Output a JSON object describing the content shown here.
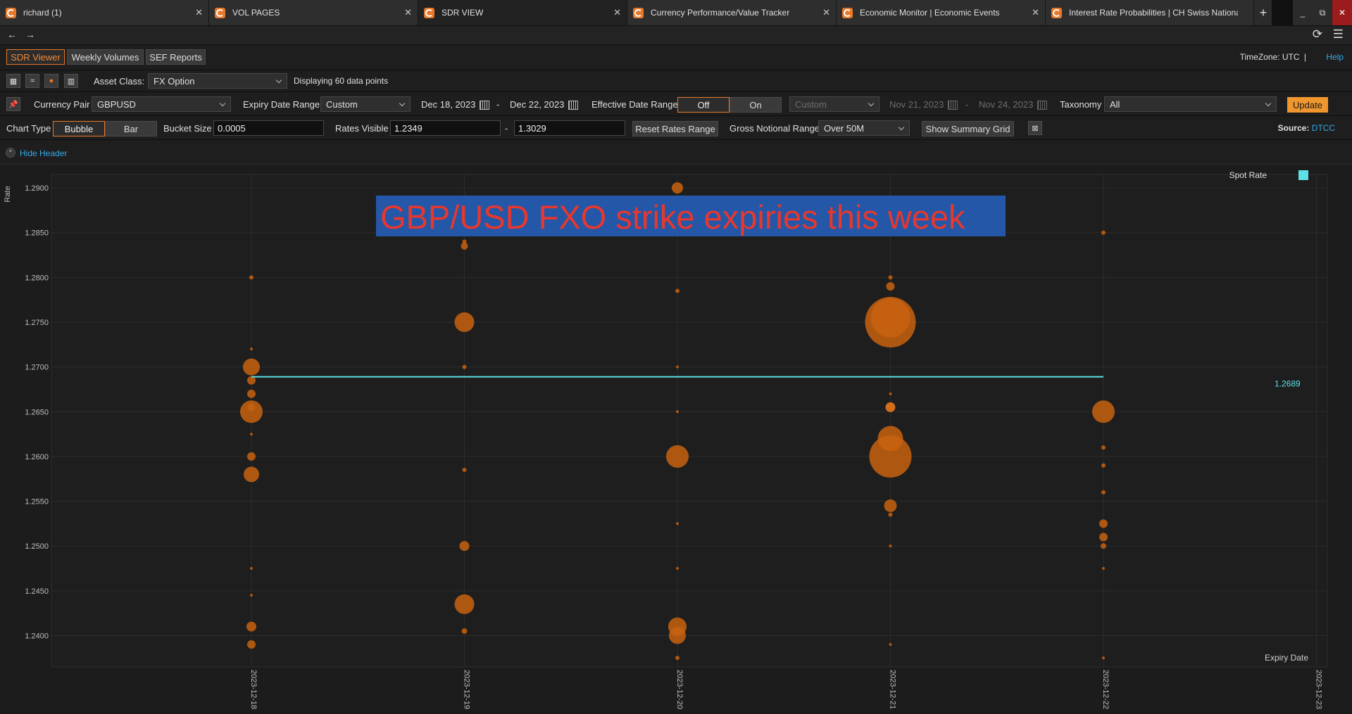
{
  "tabs": [
    {
      "label": "richard (1)",
      "active": false
    },
    {
      "label": "VOL PAGES",
      "active": false
    },
    {
      "label": "SDR VIEW",
      "active": true
    },
    {
      "label": "Currency Performance/Value Tracker",
      "active": false
    },
    {
      "label": "Economic Monitor | Economic Events",
      "active": false
    },
    {
      "label": "Interest Rate Probabilities | CH Swiss National B",
      "active": false
    }
  ],
  "toolbar": {
    "views": [
      "SDR Viewer",
      "Weekly Volumes",
      "SEF Reports"
    ],
    "timezone": "TimeZone: UTC",
    "separator": "|",
    "help": "Help"
  },
  "filters": {
    "asset_class_label": "Asset Class:",
    "asset_class": "FX Option",
    "data_points_text": "Displaying 60 data points",
    "currency_pair_label": "Currency Pair",
    "currency_pair": "GBPUSD",
    "expiry_range_label": "Expiry Date Range",
    "expiry_range": "Custom",
    "expiry_from": "Dec 18, 2023",
    "dash": "-",
    "expiry_to": "Dec 22, 2023",
    "effective_range_label": "Effective Date Range",
    "effective_off": "Off",
    "effective_on": "On",
    "effective_custom": "Custom",
    "effective_from": "Nov 21, 2023",
    "effective_to": "Nov 24, 2023",
    "taxonomy_label": "Taxonomy",
    "taxonomy": "All",
    "update": "Update",
    "chart_type_label": "Chart Type",
    "chart_type_bubble": "Bubble",
    "chart_type_bar": "Bar",
    "bucket_size_label": "Bucket Size",
    "bucket_size": "0.0005",
    "rates_visible_label": "Rates Visible",
    "rates_min": "1.2349",
    "rates_max": "1.3029",
    "reset_rates": "Reset Rates Range",
    "gross_notional_label": "Gross Notional Range",
    "gross_notional": "Over 50M",
    "show_summary": "Show Summary Grid",
    "source_label": "Source:",
    "source": "DTCC",
    "hide_header": "Hide Header"
  },
  "colors": {
    "bubble": "#c8620f",
    "bubble_bright": "#f07d1a",
    "spot_line": "#5fe0e6",
    "annotation_bg": "#2457a8",
    "annotation_text": "#e8372d"
  },
  "chart_data": {
    "type": "scatter",
    "title": "GBP/USD FXO strike expiries this week",
    "xlabel": "Expiry Date",
    "ylabel": "Rate",
    "x_ticks": [
      "2023-12-18",
      "2023-12-19",
      "2023-12-20",
      "2023-12-21",
      "2023-12-22",
      "2023-12-23"
    ],
    "y_ticks": [
      "1.2400",
      "1.2450",
      "1.2500",
      "1.2550",
      "1.2600",
      "1.2650",
      "1.2700",
      "1.2750",
      "1.2800",
      "1.2850",
      "1.2900"
    ],
    "ylim": [
      1.2365,
      1.2915
    ],
    "spot_rate": {
      "name": "Spot Rate",
      "value": 1.2689,
      "label": "1.2689",
      "x_from": "2023-12-18",
      "x_to": "2023-12-22"
    },
    "grid": true,
    "points": [
      {
        "x": "2023-12-18",
        "y": 1.28,
        "s": 3
      },
      {
        "x": "2023-12-18",
        "y": 1.272,
        "s": 2
      },
      {
        "x": "2023-12-18",
        "y": 1.27,
        "s": 12
      },
      {
        "x": "2023-12-18",
        "y": 1.2685,
        "s": 6
      },
      {
        "x": "2023-12-18",
        "y": 1.267,
        "s": 6
      },
      {
        "x": "2023-12-18",
        "y": 1.2655,
        "s": 5
      },
      {
        "x": "2023-12-18",
        "y": 1.265,
        "s": 16
      },
      {
        "x": "2023-12-18",
        "y": 1.2625,
        "s": 2
      },
      {
        "x": "2023-12-18",
        "y": 1.26,
        "s": 6
      },
      {
        "x": "2023-12-18",
        "y": 1.258,
        "s": 11
      },
      {
        "x": "2023-12-18",
        "y": 1.2475,
        "s": 2
      },
      {
        "x": "2023-12-18",
        "y": 1.2445,
        "s": 2
      },
      {
        "x": "2023-12-18",
        "y": 1.241,
        "s": 7
      },
      {
        "x": "2023-12-18",
        "y": 1.239,
        "s": 6
      },
      {
        "x": "2023-12-19",
        "y": 1.285,
        "s": 4
      },
      {
        "x": "2023-12-19",
        "y": 1.284,
        "s": 3
      },
      {
        "x": "2023-12-19",
        "y": 1.2835,
        "s": 5
      },
      {
        "x": "2023-12-19",
        "y": 1.275,
        "s": 14
      },
      {
        "x": "2023-12-19",
        "y": 1.27,
        "s": 3
      },
      {
        "x": "2023-12-19",
        "y": 1.2585,
        "s": 3
      },
      {
        "x": "2023-12-19",
        "y": 1.25,
        "s": 7
      },
      {
        "x": "2023-12-19",
        "y": 1.2435,
        "s": 14
      },
      {
        "x": "2023-12-19",
        "y": 1.2405,
        "s": 4
      },
      {
        "x": "2023-12-20",
        "y": 1.29,
        "s": 8
      },
      {
        "x": "2023-12-20",
        "y": 1.2785,
        "s": 3
      },
      {
        "x": "2023-12-20",
        "y": 1.27,
        "s": 2
      },
      {
        "x": "2023-12-20",
        "y": 1.265,
        "s": 2
      },
      {
        "x": "2023-12-20",
        "y": 1.26,
        "s": 16
      },
      {
        "x": "2023-12-20",
        "y": 1.2525,
        "s": 2
      },
      {
        "x": "2023-12-20",
        "y": 1.2475,
        "s": 2
      },
      {
        "x": "2023-12-20",
        "y": 1.241,
        "s": 13
      },
      {
        "x": "2023-12-20",
        "y": 1.24,
        "s": 12
      },
      {
        "x": "2023-12-20",
        "y": 1.2375,
        "s": 3
      },
      {
        "x": "2023-12-21",
        "y": 1.285,
        "s": 4
      },
      {
        "x": "2023-12-21",
        "y": 1.28,
        "s": 3
      },
      {
        "x": "2023-12-21",
        "y": 1.279,
        "s": 6
      },
      {
        "x": "2023-12-21",
        "y": 1.275,
        "s": 36
      },
      {
        "x": "2023-12-21",
        "y": 1.2755,
        "s": 28
      },
      {
        "x": "2023-12-21",
        "y": 1.267,
        "s": 2
      },
      {
        "x": "2023-12-21",
        "y": 1.2655,
        "s": 7,
        "bright": true
      },
      {
        "x": "2023-12-21",
        "y": 1.262,
        "s": 18
      },
      {
        "x": "2023-12-21",
        "y": 1.26,
        "s": 30
      },
      {
        "x": "2023-12-21",
        "y": 1.2545,
        "s": 9
      },
      {
        "x": "2023-12-21",
        "y": 1.2535,
        "s": 3
      },
      {
        "x": "2023-12-21",
        "y": 1.25,
        "s": 2
      },
      {
        "x": "2023-12-21",
        "y": 1.239,
        "s": 2
      },
      {
        "x": "2023-12-22",
        "y": 1.285,
        "s": 3
      },
      {
        "x": "2023-12-22",
        "y": 1.265,
        "s": 16
      },
      {
        "x": "2023-12-22",
        "y": 1.261,
        "s": 3
      },
      {
        "x": "2023-12-22",
        "y": 1.259,
        "s": 3
      },
      {
        "x": "2023-12-22",
        "y": 1.256,
        "s": 3
      },
      {
        "x": "2023-12-22",
        "y": 1.2525,
        "s": 6
      },
      {
        "x": "2023-12-22",
        "y": 1.251,
        "s": 6
      },
      {
        "x": "2023-12-22",
        "y": 1.25,
        "s": 4
      },
      {
        "x": "2023-12-22",
        "y": 1.2475,
        "s": 2
      },
      {
        "x": "2023-12-22",
        "y": 1.2375,
        "s": 2
      }
    ]
  }
}
